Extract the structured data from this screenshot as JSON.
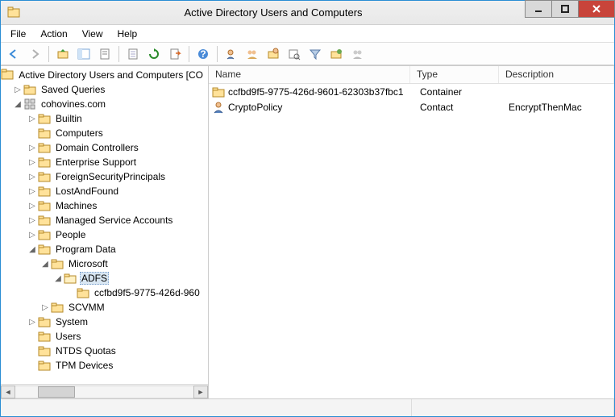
{
  "window": {
    "title": "Active Directory Users and Computers"
  },
  "menu": {
    "file": "File",
    "action": "Action",
    "view": "View",
    "help": "Help"
  },
  "tree": {
    "root_label": "Active Directory Users and Computers [CO",
    "saved_queries": "Saved Queries",
    "domain": "cohovines.com",
    "nodes": {
      "builtin": "Builtin",
      "computers": "Computers",
      "domain_controllers": "Domain Controllers",
      "enterprise_support": "Enterprise Support",
      "foreign_security_principals": "ForeignSecurityPrincipals",
      "lost_and_found": "LostAndFound",
      "machines": "Machines",
      "managed_service_accounts": "Managed Service Accounts",
      "people": "People",
      "program_data": "Program Data",
      "microsoft": "Microsoft",
      "adfs": "ADFS",
      "adfs_guid": "ccfbd9f5-9775-426d-960",
      "scvmm": "SCVMM",
      "system": "System",
      "users": "Users",
      "ntds_quotas": "NTDS Quotas",
      "tpm_devices": "TPM Devices"
    }
  },
  "list": {
    "headers": {
      "name": "Name",
      "type": "Type",
      "description": "Description"
    },
    "rows": [
      {
        "icon": "folder",
        "name": "ccfbd9f5-9775-426d-9601-62303b37fbc1",
        "type": "Container",
        "description": ""
      },
      {
        "icon": "contact",
        "name": "CryptoPolicy",
        "type": "Contact",
        "description": "EncryptThenMac"
      }
    ]
  }
}
